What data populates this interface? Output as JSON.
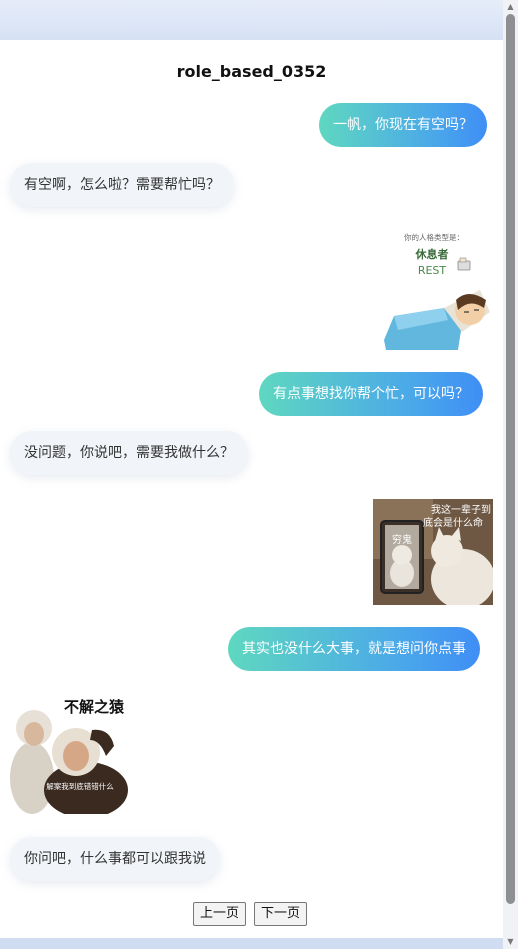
{
  "chat": {
    "title": "role_based_0352",
    "messages": [
      {
        "role": "user",
        "text": "一帆，你现在有空吗？"
      },
      {
        "role": "bot",
        "text": "有空啊，怎么啦？需要帮忙吗？"
      },
      {
        "role": "user",
        "type": "sticker",
        "caption_small": "你的人格类型是：",
        "caption_main": "休息者",
        "caption_en": "REST"
      },
      {
        "role": "user",
        "text": "有点事想找你帮个忙，可以吗？"
      },
      {
        "role": "bot",
        "text": "没问题，你说吧，需要我做什么？"
      },
      {
        "role": "user",
        "type": "sticker",
        "caption_top": "我这一辈子到底会是什么命",
        "caption_mirror": "穷鬼"
      },
      {
        "role": "user",
        "text": "其实也没什么大事，就是想问你点事"
      },
      {
        "role": "bot",
        "type": "sticker",
        "caption_title": "不解之猿",
        "caption_bottom": "解案我到底错错什么"
      },
      {
        "role": "bot",
        "text": "你问吧，什么事都可以跟我说"
      }
    ]
  },
  "pagination": {
    "prev": "上一页",
    "next": "下一页"
  },
  "colors": {
    "user_gradient_start": "#5fd7c0",
    "user_gradient_end": "#3f8ef5",
    "bot_bubble": "#f1f4f8"
  }
}
